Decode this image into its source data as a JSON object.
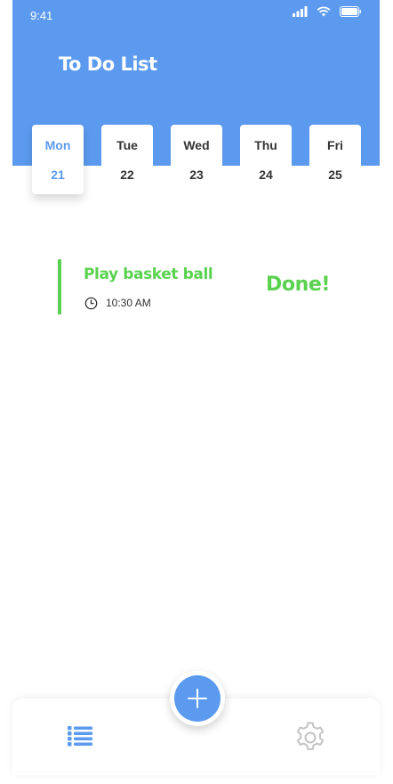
{
  "status_bar": {
    "time": "9:41",
    "icons": [
      "signal-icon",
      "wifi-icon",
      "battery-icon"
    ]
  },
  "header": {
    "title": "To Do List"
  },
  "days": [
    {
      "name": "Mon",
      "number": "21",
      "selected": true
    },
    {
      "name": "Tue",
      "number": "22",
      "selected": false
    },
    {
      "name": "Wed",
      "number": "23",
      "selected": false
    },
    {
      "name": "Thu",
      "number": "24",
      "selected": false
    },
    {
      "name": "Fri",
      "number": "25",
      "selected": false
    }
  ],
  "tasks": [
    {
      "title": "Play basket ball",
      "time": "10:30 AM",
      "status": "Done!",
      "icon": "clock-icon"
    }
  ],
  "bottom_nav": {
    "items": [
      "list-icon",
      "gear-icon"
    ],
    "fab_icon": "plus-icon"
  },
  "colors": {
    "accent": "#5b9aee",
    "done": "#5ad24f",
    "text": "#333333",
    "inactive_icon": "#c4c4c4"
  }
}
